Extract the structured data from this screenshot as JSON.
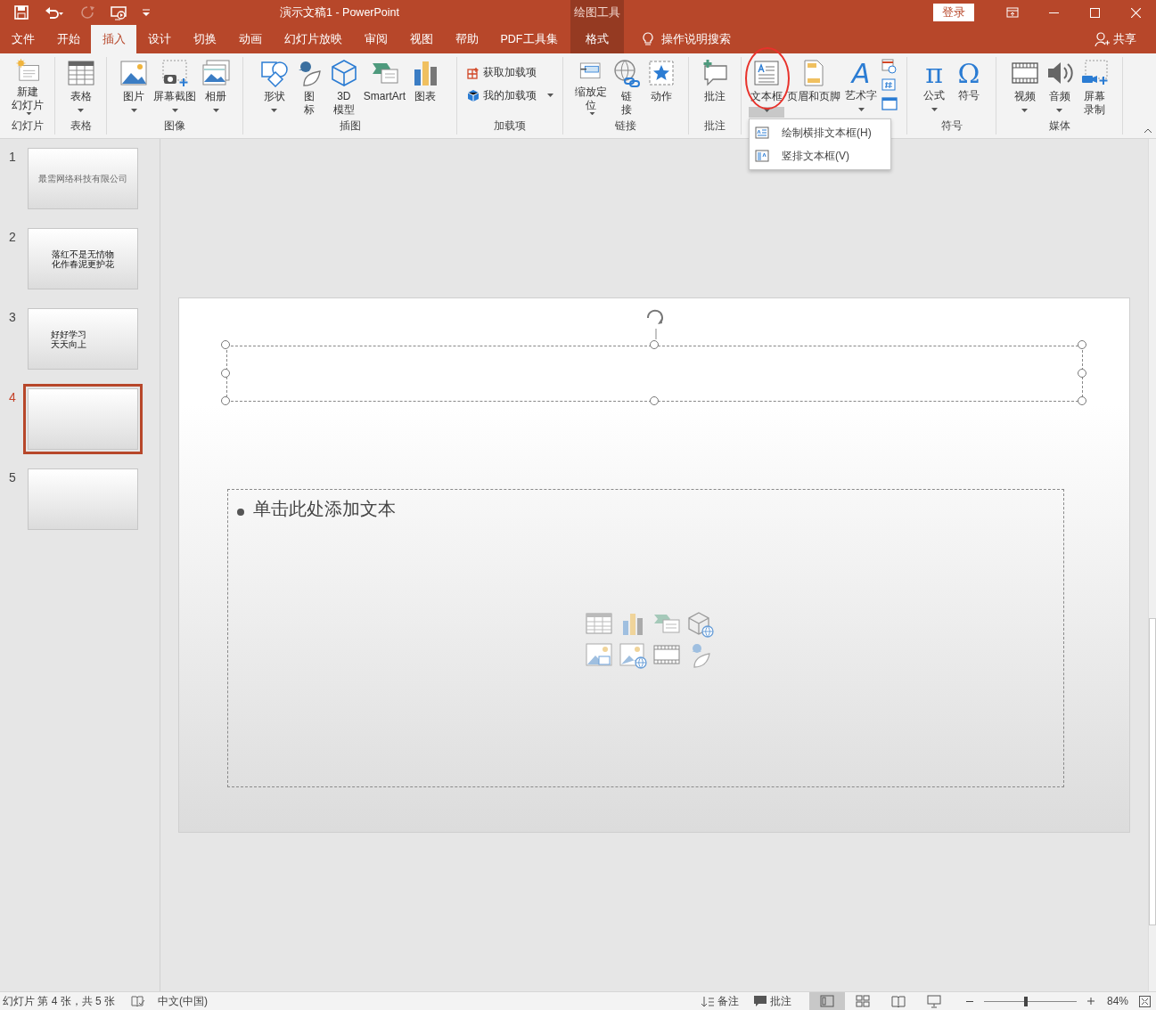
{
  "title_bar": {
    "title": "演示文稿1  -  PowerPoint",
    "context_label": "绘图工具",
    "sign_in": "登录",
    "quick_access": [
      {
        "disabled": false
      },
      {
        "disabled": false
      },
      {
        "disabled": true
      },
      {
        "disabled": false
      },
      {
        "disabled": false
      }
    ]
  },
  "tabs": [
    {
      "label": "文件",
      "selected": false,
      "kind": "normal"
    },
    {
      "label": "开始",
      "selected": false,
      "kind": "normal"
    },
    {
      "label": "插入",
      "selected": true,
      "kind": "normal"
    },
    {
      "label": "设计",
      "selected": false,
      "kind": "normal"
    },
    {
      "label": "切换",
      "selected": false,
      "kind": "normal"
    },
    {
      "label": "动画",
      "selected": false,
      "kind": "normal"
    },
    {
      "label": "幻灯片放映",
      "selected": false,
      "kind": "normal"
    },
    {
      "label": "审阅",
      "selected": false,
      "kind": "normal"
    },
    {
      "label": "视图",
      "selected": false,
      "kind": "normal"
    },
    {
      "label": "帮助",
      "selected": false,
      "kind": "normal"
    },
    {
      "label": "PDF工具集",
      "selected": false,
      "kind": "normal"
    },
    {
      "label": "格式",
      "selected": false,
      "kind": "context"
    }
  ],
  "tell_me": "操作说明搜索",
  "share": "共享",
  "ribbon_groups": [
    {
      "label": "幻灯片",
      "items": [
        {
          "kind": "large",
          "lines": [
            "新建",
            "幻灯片"
          ],
          "dropdown": true
        }
      ]
    },
    {
      "label": "表格",
      "items": [
        {
          "kind": "large",
          "lines": [
            "表格"
          ],
          "dropdown": true
        }
      ]
    },
    {
      "label": "图像",
      "items": [
        {
          "kind": "large",
          "lines": [
            "图片"
          ],
          "dropdown": true
        },
        {
          "kind": "large",
          "lines": [
            "屏幕截图"
          ],
          "dropdown": true
        },
        {
          "kind": "large",
          "lines": [
            "相册"
          ],
          "dropdown": true
        }
      ]
    },
    {
      "label": "插图",
      "items": [
        {
          "kind": "large",
          "lines": [
            "形状"
          ],
          "dropdown": true
        },
        {
          "kind": "large",
          "lines": [
            "图",
            "标"
          ],
          "dropdown": false
        },
        {
          "kind": "large",
          "lines": [
            "3D",
            "模型"
          ],
          "dropdown": false
        },
        {
          "kind": "large",
          "lines": [
            "SmartArt"
          ],
          "dropdown": false
        },
        {
          "kind": "large",
          "lines": [
            "图表"
          ],
          "dropdown": false
        }
      ]
    },
    {
      "label": "加载项",
      "items": [
        {
          "kind": "small",
          "lines": [
            "获取加载项"
          ],
          "dropdown": false
        },
        {
          "kind": "small",
          "lines": [
            "我的加载项"
          ],
          "dropdown": true
        }
      ]
    },
    {
      "label": "链接",
      "items": [
        {
          "kind": "large",
          "lines": [
            "缩放定",
            "位"
          ],
          "dropdown": true
        },
        {
          "kind": "large",
          "lines": [
            "链",
            "接"
          ],
          "dropdown": false
        },
        {
          "kind": "large",
          "lines": [
            "动作"
          ],
          "dropdown": false
        }
      ]
    },
    {
      "label": "批注",
      "items": [
        {
          "kind": "large",
          "lines": [
            "批注"
          ],
          "dropdown": false
        }
      ]
    },
    {
      "items": [
        {
          "kind": "large",
          "lines": [
            "文本框"
          ],
          "dropdown": true,
          "pressed": true
        },
        {
          "kind": "large",
          "lines": [
            "页眉和页脚"
          ],
          "dropdown": false
        },
        {
          "kind": "large",
          "lines": [
            "艺术字"
          ],
          "dropdown": true,
          "glyph": "A"
        },
        {
          "kind": "stack"
        }
      ]
    },
    {
      "label": "符号",
      "items": [
        {
          "kind": "large",
          "lines": [
            "公式"
          ],
          "dropdown": true,
          "glyph": "π"
        },
        {
          "kind": "large",
          "lines": [
            "符号"
          ],
          "dropdown": false,
          "glyph": "Ω"
        }
      ]
    },
    {
      "label": "媒体",
      "items": [
        {
          "kind": "large",
          "lines": [
            "视频"
          ],
          "dropdown": true
        },
        {
          "kind": "large",
          "lines": [
            "音频"
          ],
          "dropdown": true
        },
        {
          "kind": "large",
          "lines": [
            "屏幕",
            "录制"
          ],
          "dropdown": false
        }
      ]
    }
  ],
  "textbox_menu": [
    "绘制横排文本框(H)",
    "竖排文本框(V)"
  ],
  "annotation": {
    "kind": "circle"
  },
  "slides": [
    {
      "number": "1",
      "selected": false,
      "lines": [
        "最需网络科技有限公司"
      ]
    },
    {
      "number": "2",
      "selected": false,
      "lines": [
        "落红不是无情物",
        "化作春泥更护花"
      ]
    },
    {
      "number": "3",
      "selected": false,
      "lines": [
        "好好学习",
        "天天向上"
      ]
    },
    {
      "number": "4",
      "selected": true
    },
    {
      "number": "5",
      "selected": false
    }
  ],
  "title_placeholder": {
    "selected": true
  },
  "body_placeholder": {
    "text": "单击此处添加文本"
  },
  "status_bar": {
    "slide_info": "幻灯片 第 4 张，共 5 张",
    "language": "中文(中国)",
    "notes": "备注",
    "comments": "批注",
    "views": [
      {
        "selected": true
      },
      {
        "selected": false
      },
      {
        "selected": false
      },
      {
        "selected": false
      }
    ],
    "zoom": {
      "level": 0.45,
      "reading": "84%"
    }
  }
}
